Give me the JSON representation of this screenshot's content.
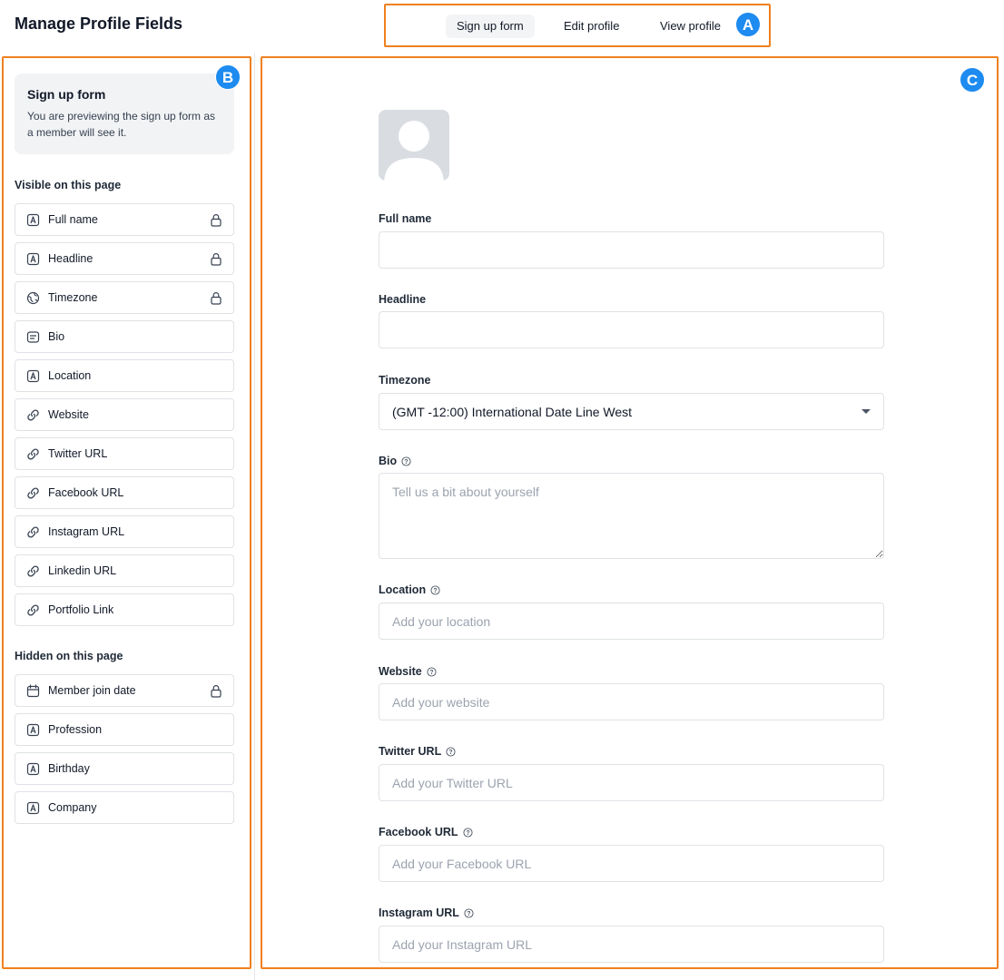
{
  "header": {
    "title": "Manage Profile Fields"
  },
  "tabs": [
    {
      "label": "Sign up form",
      "active": true
    },
    {
      "label": "Edit profile",
      "active": false
    },
    {
      "label": "View profile",
      "active": false
    }
  ],
  "markers": {
    "a": "A",
    "b": "B",
    "c": "C"
  },
  "sidebar": {
    "card_title": "Sign up form",
    "card_text": "You are previewing the sign up form as a member will see it.",
    "visible_label": "Visible on this page",
    "hidden_label": "Hidden on this page",
    "visible_items": [
      {
        "label": "Full name",
        "icon": "text-icon",
        "locked": true
      },
      {
        "label": "Headline",
        "icon": "text-icon",
        "locked": true
      },
      {
        "label": "Timezone",
        "icon": "globe-icon",
        "locked": true
      },
      {
        "label": "Bio",
        "icon": "paragraph-icon",
        "locked": false
      },
      {
        "label": "Location",
        "icon": "text-icon",
        "locked": false
      },
      {
        "label": "Website",
        "icon": "link-icon",
        "locked": false
      },
      {
        "label": "Twitter URL",
        "icon": "link-icon",
        "locked": false
      },
      {
        "label": "Facebook URL",
        "icon": "link-icon",
        "locked": false
      },
      {
        "label": "Instagram URL",
        "icon": "link-icon",
        "locked": false
      },
      {
        "label": "Linkedin URL",
        "icon": "link-icon",
        "locked": false
      },
      {
        "label": "Portfolio Link",
        "icon": "link-icon",
        "locked": false
      }
    ],
    "hidden_items": [
      {
        "label": "Member join date",
        "icon": "calendar-icon",
        "locked": true
      },
      {
        "label": "Profession",
        "icon": "text-icon",
        "locked": false
      },
      {
        "label": "Birthday",
        "icon": "text-icon",
        "locked": false
      },
      {
        "label": "Company",
        "icon": "text-icon",
        "locked": false
      }
    ]
  },
  "form": {
    "full_name": {
      "label": "Full name",
      "value": "",
      "placeholder": ""
    },
    "headline": {
      "label": "Headline",
      "value": "",
      "placeholder": ""
    },
    "timezone": {
      "label": "Timezone",
      "value": "(GMT -12:00) International Date Line West"
    },
    "bio": {
      "label": "Bio",
      "placeholder": "Tell us a bit about yourself"
    },
    "location": {
      "label": "Location",
      "placeholder": "Add your location"
    },
    "website": {
      "label": "Website",
      "placeholder": "Add your website"
    },
    "twitter": {
      "label": "Twitter URL",
      "placeholder": "Add your Twitter URL"
    },
    "facebook": {
      "label": "Facebook URL",
      "placeholder": "Add your Facebook URL"
    },
    "instagram": {
      "label": "Instagram URL",
      "placeholder": "Add your Instagram URL"
    }
  },
  "colors": {
    "highlight": "#f0801f",
    "marker": "#1d8bf0",
    "border": "#dfe2e6"
  }
}
